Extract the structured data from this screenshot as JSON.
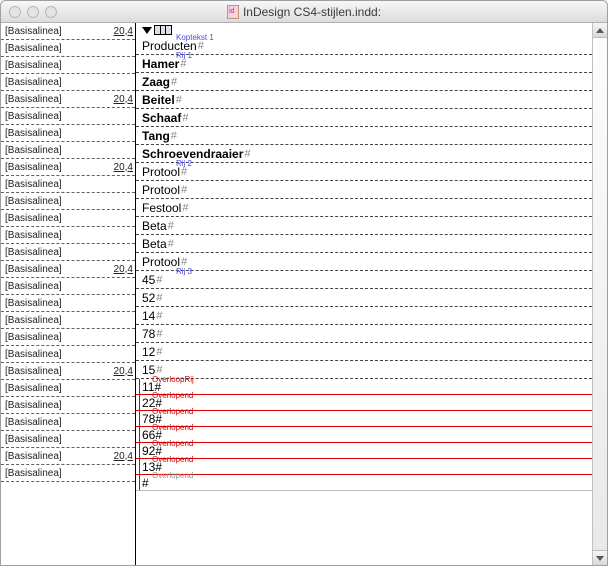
{
  "window": {
    "title": "InDesign CS4-stijlen.indd:"
  },
  "left_panel": {
    "style_label": "[Basisalinea]",
    "number": "20,4",
    "rows": [
      {
        "show_num": true
      },
      {
        "show_num": false
      },
      {
        "show_num": false
      },
      {
        "show_num": false
      },
      {
        "show_num": true
      },
      {
        "show_num": false
      },
      {
        "show_num": false
      },
      {
        "show_num": false
      },
      {
        "show_num": true
      },
      {
        "show_num": false
      },
      {
        "show_num": false
      },
      {
        "show_num": false
      },
      {
        "show_num": false
      },
      {
        "show_num": false
      },
      {
        "show_num": true
      },
      {
        "show_num": false
      },
      {
        "show_num": false
      },
      {
        "show_num": false
      },
      {
        "show_num": false
      },
      {
        "show_num": false
      },
      {
        "show_num": true
      },
      {
        "show_num": false
      },
      {
        "show_num": false
      },
      {
        "show_num": false
      },
      {
        "show_num": false
      },
      {
        "show_num": true
      },
      {
        "show_num": false
      }
    ]
  },
  "annotations": {
    "kop": "Koptekst 1",
    "rij1": "Rij 1",
    "rij2": "Rij 2",
    "rij3": "Rij 3",
    "overloop_rij": "OverloopRij",
    "overlopend": "Overlopend"
  },
  "normal_rows": [
    {
      "text": "Producten",
      "bold": false,
      "anno_after": "kop"
    },
    {
      "text": "Hamer",
      "bold": true,
      "anno_after": "rij1"
    },
    {
      "text": "Zaag",
      "bold": true,
      "anno_after": null
    },
    {
      "text": "Beitel",
      "bold": true,
      "anno_after": null
    },
    {
      "text": "Schaaf",
      "bold": true,
      "anno_after": null
    },
    {
      "text": "Tang",
      "bold": true,
      "anno_after": null
    },
    {
      "text": "Schroevendraaier",
      "bold": true,
      "anno_after": null
    },
    {
      "text": "Protool",
      "bold": false,
      "anno_after": "rij2"
    },
    {
      "text": "Protool",
      "bold": false,
      "anno_after": null
    },
    {
      "text": "Festool",
      "bold": false,
      "anno_after": null
    },
    {
      "text": "Beta",
      "bold": false,
      "anno_after": null
    },
    {
      "text": "Beta",
      "bold": false,
      "anno_after": null
    },
    {
      "text": "Protool",
      "bold": false,
      "anno_after": null
    },
    {
      "text": "45",
      "bold": false,
      "anno_after": "rij3"
    },
    {
      "text": "52",
      "bold": false,
      "anno_after": null
    },
    {
      "text": "14",
      "bold": false,
      "anno_after": null
    },
    {
      "text": "78",
      "bold": false,
      "anno_after": null
    },
    {
      "text": "12",
      "bold": false,
      "anno_after": null
    },
    {
      "text": "15",
      "bold": false,
      "anno_after": null
    }
  ],
  "red_rows": [
    {
      "text": "11",
      "label": "overloop_rij"
    },
    {
      "text": "22",
      "label": "overlopend"
    },
    {
      "text": "78",
      "label": "overlopend"
    },
    {
      "text": "66",
      "label": "overlopend"
    },
    {
      "text": "92",
      "label": "overlopend"
    },
    {
      "text": "13",
      "label": "overlopend"
    },
    {
      "text": "",
      "label": "overlopend",
      "grey": true
    }
  ],
  "hash": "#"
}
